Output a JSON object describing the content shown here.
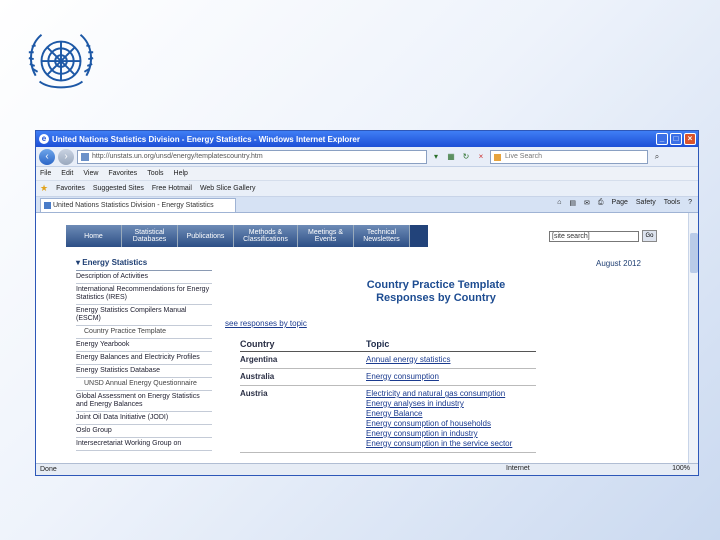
{
  "window": {
    "title": "United Nations Statistics Division - Energy Statistics - Windows Internet Explorer"
  },
  "address": {
    "url": "http://unstats.un.org/unsd/energy/templatescountry.htm",
    "search_placeholder": "Live Search"
  },
  "menu": [
    "File",
    "Edit",
    "View",
    "Favorites",
    "Tools",
    "Help"
  ],
  "favorites_bar": {
    "favorites": "Favorites",
    "suggested": "Suggested Sites",
    "hotmail": "Free Hotmail",
    "gallery": "Web Slice Gallery"
  },
  "tab": {
    "title": "United Nations Statistics Division - Energy Statistics"
  },
  "commandbar": [
    "Page",
    "Safety",
    "Tools"
  ],
  "site_nav": [
    "Home",
    "Statistical Databases",
    "Publications",
    "Methods & Classifications",
    "Meetings & Events",
    "Technical Newsletters"
  ],
  "site_search": {
    "placeholder": "[site search]",
    "go": "Go"
  },
  "sidebar": {
    "heading": "Energy Statistics",
    "items": [
      {
        "label": "Description of Activities",
        "sub": false
      },
      {
        "label": "International Recommendations for Energy Statistics (IRES)",
        "sub": false
      },
      {
        "label": "Energy Statistics Compilers Manual (ESCM)",
        "sub": false
      },
      {
        "label": "Country Practice Template",
        "sub": true
      },
      {
        "label": "Energy Yearbook",
        "sub": false
      },
      {
        "label": "Energy Balances and Electricity Profiles",
        "sub": false
      },
      {
        "label": "Energy Statistics Database",
        "sub": false
      },
      {
        "label": "UNSD Annual Energy Questionnaire",
        "sub": true
      },
      {
        "label": "Global Assessment on Energy Statistics and Energy Balances",
        "sub": false
      },
      {
        "label": "Joint Oil Data Initiative (JODI)",
        "sub": false
      },
      {
        "label": "Oslo Group",
        "sub": false
      },
      {
        "label": "Intersecretariat Working Group on",
        "sub": false
      }
    ]
  },
  "date": "August 2012",
  "page_title": {
    "line1": "Country Practice Template",
    "line2": "Responses by Country"
  },
  "see_link": "see responses by topic",
  "table": {
    "headers": {
      "country": "Country",
      "topic": "Topic"
    },
    "rows": [
      {
        "country": "Argentina",
        "topics": [
          "Annual energy statistics"
        ]
      },
      {
        "country": "Australia",
        "topics": [
          "Energy consumption"
        ]
      },
      {
        "country": "Austria",
        "topics": [
          "Electricity and natural gas consumption",
          "Energy analyses in industry",
          "Energy Balance",
          "Energy consumption of households",
          "Energy consumption in industry",
          "Energy consumption in the service sector"
        ]
      }
    ]
  },
  "status": {
    "left": "Done",
    "zone": "Internet",
    "zoom": "100%"
  }
}
